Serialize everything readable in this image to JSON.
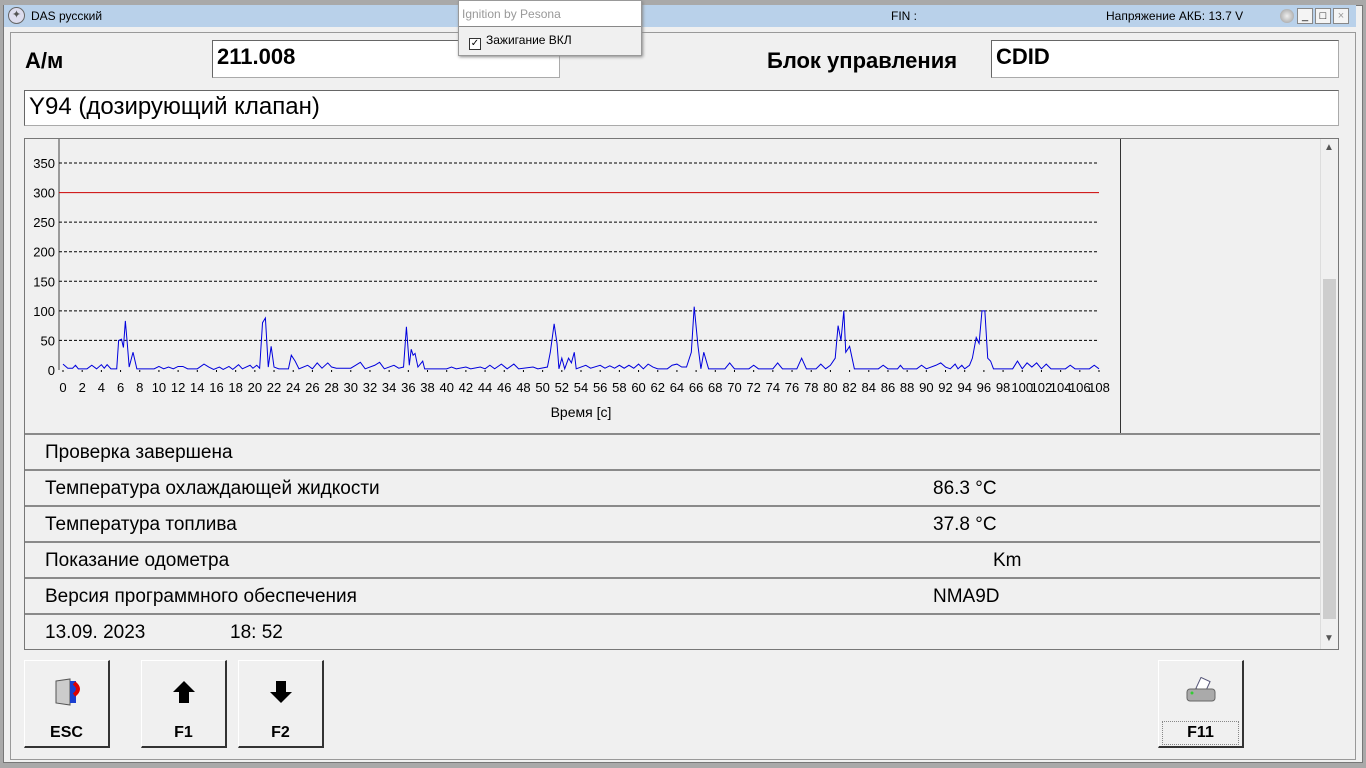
{
  "titlebar": {
    "title": "DAS русский",
    "fin": "FIN :",
    "voltage": "Напряжение АКБ: 13.7 V",
    "min": "_",
    "max": "□",
    "close": "×"
  },
  "popup": {
    "header": "Ignition by Pesona",
    "checkbox_label": "Зажигание ВКЛ",
    "checked": true
  },
  "header": {
    "vehicle_label": "А/м",
    "vehicle_value": "211.008",
    "ecu_label": "Блок управления",
    "ecu_value": "CDID",
    "component": "Y94 (дозирующий клапан)"
  },
  "rows": [
    {
      "label": "Проверка завершена",
      "value": ""
    },
    {
      "label": "Температура охлаждающей жидкости",
      "value": "86.3 °C"
    },
    {
      "label": "Температура топлива",
      "value": "37.8 °C"
    },
    {
      "label": "Показание одометра",
      "value": "Km"
    },
    {
      "label": "Версия программного обеспечения",
      "value": "NMA9D"
    }
  ],
  "footer_row": {
    "date": "13.09. 2023",
    "time": "18: 52"
  },
  "buttons": [
    {
      "label": "ESC",
      "icon": "exit-door-icon"
    },
    {
      "label": "F1",
      "icon": "arrow-up-icon"
    },
    {
      "label": "F2",
      "icon": "arrow-down-icon"
    },
    {
      "label": "F11",
      "icon": "printer-icon"
    }
  ],
  "chart_data": {
    "type": "line",
    "xlabel": "Время [с]",
    "ylabel": "",
    "xlim": [
      0,
      108
    ],
    "ylim": [
      0,
      350
    ],
    "xticks": [
      0,
      2,
      4,
      6,
      8,
      10,
      12,
      14,
      16,
      18,
      20,
      22,
      24,
      26,
      28,
      30,
      32,
      34,
      36,
      38,
      40,
      42,
      44,
      46,
      48,
      50,
      52,
      54,
      56,
      58,
      60,
      62,
      64,
      66,
      68,
      70,
      72,
      74,
      76,
      78,
      80,
      82,
      84,
      86,
      88,
      90,
      92,
      94,
      96,
      98,
      100,
      102,
      104,
      106,
      108
    ],
    "yticks": [
      0,
      50,
      100,
      150,
      200,
      250,
      300,
      350
    ],
    "threshold": {
      "value": 300,
      "color": "#cc0000"
    },
    "series_color": "#0000dd",
    "points": [
      [
        0,
        10
      ],
      [
        0.5,
        3
      ],
      [
        1,
        3
      ],
      [
        1.3,
        8
      ],
      [
        1.6,
        2
      ],
      [
        2.5,
        2
      ],
      [
        3,
        8
      ],
      [
        3.5,
        2
      ],
      [
        4,
        9
      ],
      [
        4.3,
        3
      ],
      [
        4.6,
        9
      ],
      [
        5,
        2
      ],
      [
        5.6,
        2
      ],
      [
        5.8,
        50
      ],
      [
        6.1,
        52
      ],
      [
        6.3,
        38
      ],
      [
        6.5,
        83
      ],
      [
        6.7,
        45
      ],
      [
        6.9,
        5
      ],
      [
        7.3,
        30
      ],
      [
        7.7,
        2
      ],
      [
        9.5,
        2
      ],
      [
        10,
        6
      ],
      [
        10.5,
        2
      ],
      [
        11,
        5
      ],
      [
        11.5,
        2
      ],
      [
        12,
        6
      ],
      [
        12.5,
        6
      ],
      [
        13,
        2
      ],
      [
        14,
        2
      ],
      [
        14.7,
        10
      ],
      [
        15.2,
        5
      ],
      [
        15.7,
        1
      ],
      [
        16.3,
        5
      ],
      [
        16.7,
        1
      ],
      [
        17.3,
        6
      ],
      [
        17.7,
        1
      ],
      [
        18.3,
        9
      ],
      [
        18.7,
        2
      ],
      [
        19.5,
        8
      ],
      [
        19.8,
        3
      ],
      [
        20.2,
        8
      ],
      [
        20.5,
        3
      ],
      [
        20.8,
        80
      ],
      [
        21.1,
        88
      ],
      [
        21.4,
        5
      ],
      [
        21.7,
        40
      ],
      [
        22,
        5
      ],
      [
        22.5,
        2
      ],
      [
        23.5,
        2
      ],
      [
        23.8,
        25
      ],
      [
        24.2,
        15
      ],
      [
        24.6,
        2
      ],
      [
        25.5,
        8
      ],
      [
        26,
        2
      ],
      [
        26.5,
        12
      ],
      [
        27,
        3
      ],
      [
        27.6,
        12
      ],
      [
        28,
        5
      ],
      [
        28.5,
        3
      ],
      [
        30,
        3
      ],
      [
        30.5,
        8
      ],
      [
        31,
        13
      ],
      [
        31.5,
        2
      ],
      [
        32.5,
        8
      ],
      [
        33,
        13
      ],
      [
        33.5,
        2
      ],
      [
        34.5,
        8
      ],
      [
        35,
        3
      ],
      [
        35.5,
        5
      ],
      [
        35.8,
        73
      ],
      [
        36.1,
        8
      ],
      [
        36.3,
        35
      ],
      [
        36.5,
        25
      ],
      [
        36.7,
        28
      ],
      [
        37,
        5
      ],
      [
        37.5,
        15
      ],
      [
        37.7,
        2
      ],
      [
        40,
        2
      ],
      [
        40.5,
        5
      ],
      [
        41,
        2
      ],
      [
        42,
        5
      ],
      [
        42.5,
        2
      ],
      [
        43.5,
        5
      ],
      [
        44,
        2
      ],
      [
        44.5,
        8
      ],
      [
        45,
        2
      ],
      [
        45.7,
        10
      ],
      [
        46.3,
        2
      ],
      [
        47,
        10
      ],
      [
        47.5,
        2
      ],
      [
        49,
        5
      ],
      [
        49.5,
        2
      ],
      [
        50.5,
        5
      ],
      [
        50.8,
        30
      ],
      [
        51.2,
        78
      ],
      [
        51.5,
        45
      ],
      [
        51.7,
        2
      ],
      [
        52,
        20
      ],
      [
        52.3,
        2
      ],
      [
        52.7,
        20
      ],
      [
        53,
        12
      ],
      [
        53.3,
        30
      ],
      [
        53.5,
        2
      ],
      [
        54.5,
        8
      ],
      [
        55,
        3
      ],
      [
        56,
        8
      ],
      [
        56.5,
        3
      ],
      [
        57,
        7
      ],
      [
        57.5,
        3
      ],
      [
        58,
        8
      ],
      [
        58.5,
        3
      ],
      [
        59,
        8
      ],
      [
        59.5,
        3
      ],
      [
        60,
        10
      ],
      [
        60.5,
        2
      ],
      [
        61,
        10
      ],
      [
        61.5,
        5
      ],
      [
        62,
        2
      ],
      [
        63,
        2
      ],
      [
        63.5,
        8
      ],
      [
        64,
        10
      ],
      [
        64.5,
        5
      ],
      [
        65,
        5
      ],
      [
        65.5,
        30
      ],
      [
        65.8,
        107
      ],
      [
        66.2,
        40
      ],
      [
        66.5,
        2
      ],
      [
        66.8,
        30
      ],
      [
        67.3,
        2
      ],
      [
        69,
        2
      ],
      [
        69.5,
        12
      ],
      [
        70,
        2
      ],
      [
        71.5,
        2
      ],
      [
        72,
        8
      ],
      [
        72.5,
        2
      ],
      [
        74,
        2
      ],
      [
        74.5,
        12
      ],
      [
        75,
        2
      ],
      [
        76.5,
        2
      ],
      [
        77,
        20
      ],
      [
        77.5,
        2
      ],
      [
        78.5,
        2
      ],
      [
        79,
        10
      ],
      [
        79.5,
        2
      ],
      [
        80,
        8
      ],
      [
        80.5,
        20
      ],
      [
        80.8,
        75
      ],
      [
        81.1,
        50
      ],
      [
        81.4,
        100
      ],
      [
        81.6,
        30
      ],
      [
        82,
        40
      ],
      [
        82.5,
        2
      ],
      [
        85,
        2
      ],
      [
        85.5,
        8
      ],
      [
        86,
        2
      ],
      [
        87,
        2
      ],
      [
        87.3,
        8
      ],
      [
        87.6,
        2
      ],
      [
        89,
        2
      ],
      [
        89.5,
        8
      ],
      [
        90,
        2
      ],
      [
        91,
        8
      ],
      [
        91.5,
        12
      ],
      [
        92,
        5
      ],
      [
        92.5,
        2
      ],
      [
        93,
        10
      ],
      [
        93.3,
        2
      ],
      [
        93.7,
        8
      ],
      [
        94,
        2
      ],
      [
        94.5,
        8
      ],
      [
        94.8,
        20
      ],
      [
        95.2,
        55
      ],
      [
        95.5,
        45
      ],
      [
        95.8,
        100
      ],
      [
        96.1,
        100
      ],
      [
        96.4,
        20
      ],
      [
        96.7,
        15
      ],
      [
        97,
        2
      ],
      [
        99,
        2
      ],
      [
        99.5,
        15
      ],
      [
        100,
        2
      ],
      [
        100.5,
        12
      ],
      [
        101,
        5
      ],
      [
        101.5,
        12
      ],
      [
        102,
        2
      ],
      [
        102.5,
        10
      ],
      [
        103,
        2
      ],
      [
        104.5,
        2
      ],
      [
        105,
        8
      ],
      [
        105.5,
        2
      ],
      [
        107,
        2
      ],
      [
        107.5,
        8
      ],
      [
        108,
        2
      ]
    ]
  }
}
